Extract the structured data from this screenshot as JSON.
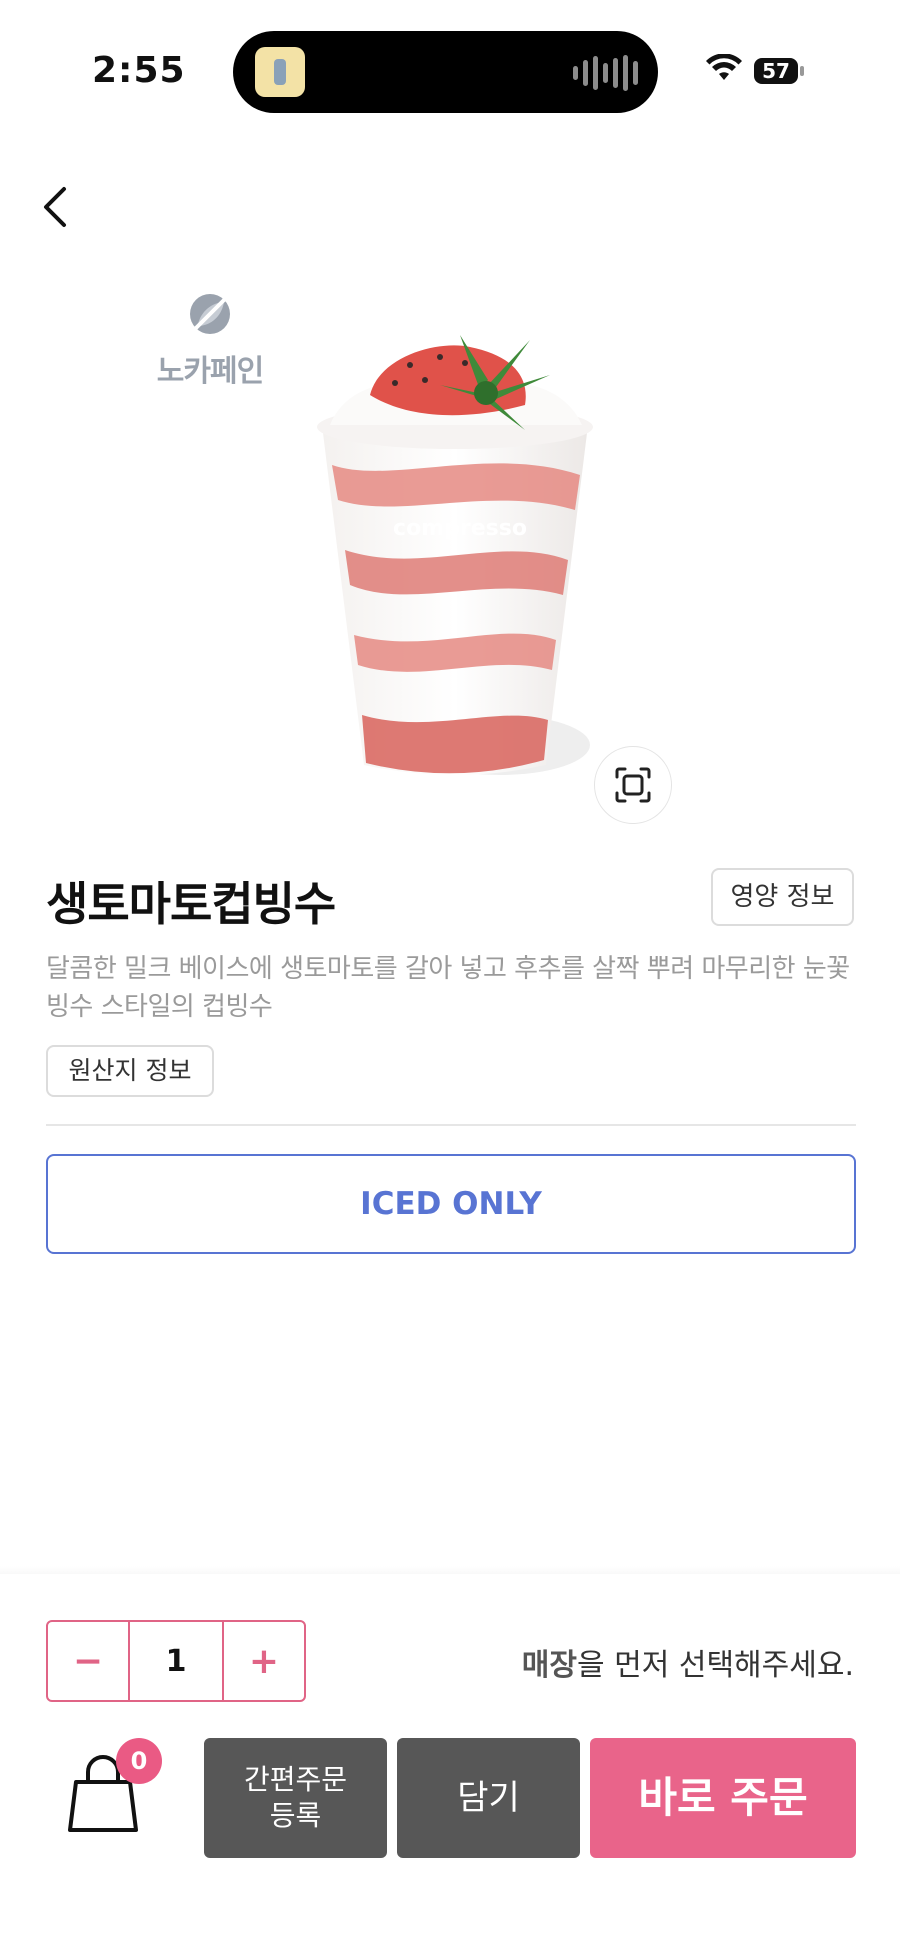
{
  "status_bar": {
    "time": "2:55",
    "battery": "57"
  },
  "header": {
    "back_icon": "chevron-left-icon"
  },
  "brand": {
    "name": "노카페인",
    "icon": "leaf-slash-icon"
  },
  "product": {
    "image_icon": "tomato-bingsu-cup-image",
    "cup_print": "compresso",
    "zoom_icon": "zoom-frame-icon",
    "title": "생토마토컵빙수",
    "description": "달콤한 밀크 베이스에 생토마토를 갈아 넣고  후추를 살짝 뿌려 마무리한 눈꽃빙수 스타일의 컵빙수",
    "nutrition_button": "영양 정보",
    "origin_button": "원산지 정보",
    "temperature_option": "ICED ONLY"
  },
  "order_panel": {
    "quantity": "1",
    "minus_label": "−",
    "plus_label": "+",
    "store_msg_bold": "매장",
    "store_msg_rest": "을 먼저 선택해주세요.",
    "cart_icon": "shopping-bag-icon",
    "cart_count": "0",
    "quick_order_line1": "간편주문",
    "quick_order_line2": "등록",
    "add_to_cart": "담기",
    "order_now": "바로 주문"
  },
  "colors": {
    "accent_pink": "#e9648a",
    "accent_blue": "#5874d3",
    "dark_button": "#575757"
  }
}
